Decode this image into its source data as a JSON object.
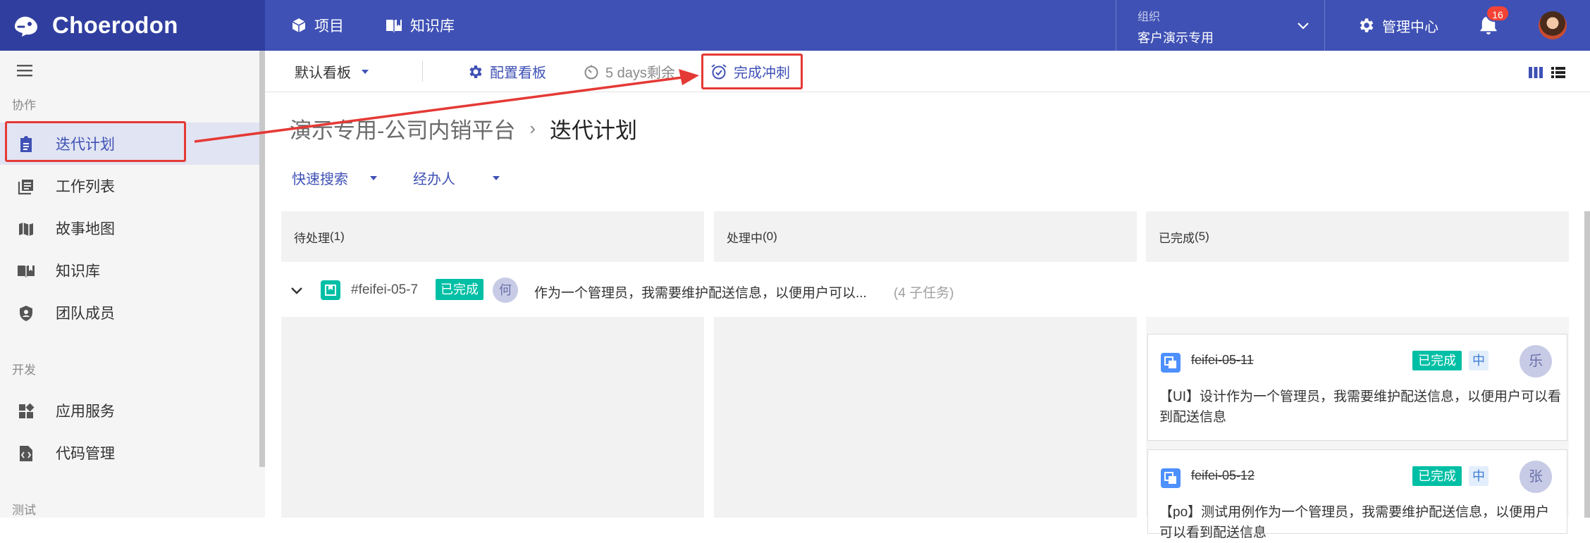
{
  "header": {
    "brand": "Choerodon",
    "nav": [
      {
        "label": "项目",
        "icon": "cube-icon"
      },
      {
        "label": "知识库",
        "icon": "book-icon"
      }
    ],
    "org": {
      "label": "组织",
      "value": "客户演示专用"
    },
    "admin": "管理中心",
    "notifications": "16"
  },
  "sidebar": {
    "sections": [
      {
        "label": "协作",
        "items": [
          {
            "label": "迭代计划",
            "icon": "clipboard-icon",
            "active": true
          },
          {
            "label": "工作列表",
            "icon": "list-icon"
          },
          {
            "label": "故事地图",
            "icon": "map-icon"
          },
          {
            "label": "知识库",
            "icon": "book-icon"
          },
          {
            "label": "团队成员",
            "icon": "shield-icon"
          }
        ]
      },
      {
        "label": "开发",
        "items": [
          {
            "label": "应用服务",
            "icon": "widgets-icon"
          },
          {
            "label": "代码管理",
            "icon": "code-icon"
          }
        ]
      },
      {
        "label": "测试",
        "items": []
      }
    ]
  },
  "toolbar": {
    "board": "默认看板",
    "config": "配置看板",
    "days": "5 days剩余",
    "finish": "完成冲刺"
  },
  "page": {
    "project": "演示专用-公司内销平台",
    "separator": "›",
    "title": "迭代计划",
    "filters": {
      "quick": "快速搜索",
      "assignee": "经办人"
    }
  },
  "columns": [
    {
      "label": "待处理",
      "count": "(1)"
    },
    {
      "label": "处理中",
      "count": "(0)"
    },
    {
      "label": "已完成",
      "count": "(5)"
    }
  ],
  "story": {
    "key": "#feifei-05-7",
    "status": "已完成",
    "assignee": "何",
    "summary": "作为一个管理员，我需要维护配送信息，以便用户可以...",
    "subtasks": "(4 子任务)"
  },
  "cards": [
    {
      "key": "feifei-05-11",
      "status": "已完成",
      "priority": "中",
      "assignee": "乐",
      "summary": "【UI】设计作为一个管理员，我需要维护配送信息，以便用户可以看到配送信息"
    },
    {
      "key": "feifei-05-12",
      "status": "已完成",
      "priority": "中",
      "assignee": "张",
      "summary": "【po】测试用例作为一个管理员，我需要维护配送信息，以便用户可以看到配送信息"
    }
  ],
  "colors": {
    "primary": "#3f51b5",
    "primary_dark": "#303f9f",
    "done": "#00bfa5",
    "annotation": "#e53935"
  }
}
